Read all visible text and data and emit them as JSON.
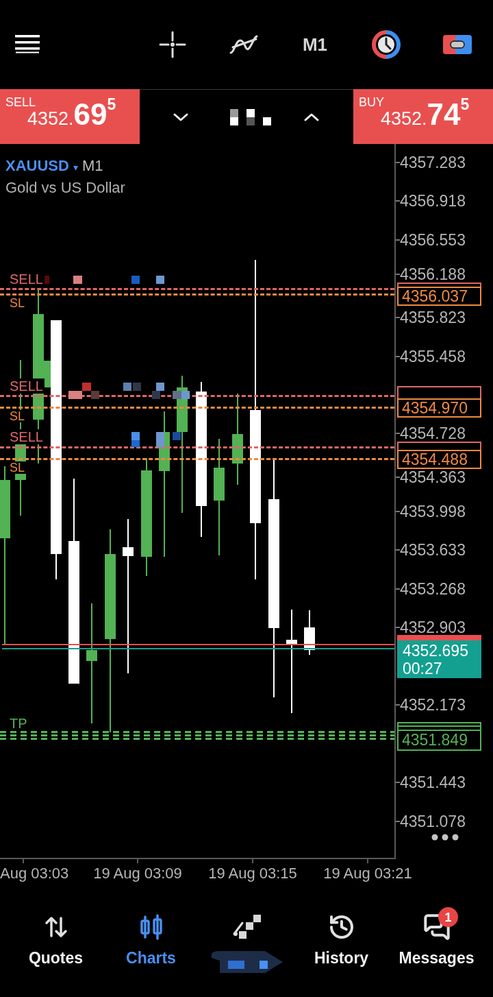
{
  "toolbar": {
    "timeframe": "M1"
  },
  "quote_bar": {
    "sell": {
      "label": "SELL",
      "price": "4352.**69**$^{5}$"
    },
    "buy": {
      "label": "BUY",
      "price": "4352.**74**$^{5}$"
    }
  },
  "chart": {
    "symbol": "XAUUSD",
    "symbol_menu_glyph": "▾",
    "timeframe": "M1",
    "description": "Gold vs US Dollar",
    "orders": [
      {
        "entry_label": "SELL",
        "sl_label": "SL",
        "sl_price": "4356.037"
      },
      {
        "entry_label": "SELL",
        "sl_label": "SL",
        "sl_price": "4354.970"
      },
      {
        "entry_label": "SELL",
        "sl_label": "SL",
        "sl_price": "4354.488"
      }
    ],
    "take_profit": {
      "label": "TP",
      "price": "4351.849"
    },
    "bid": {
      "price": "4352.695",
      "countdown": "00:27"
    },
    "price_axis": [
      "4357.283",
      "4356.918",
      "4356.553",
      "4356.188",
      "4355.823",
      "4355.458",
      "4354.728",
      "4354.363",
      "4353.998",
      "4353.633",
      "4353.268",
      "4352.903",
      "4352.173",
      "4351.443",
      "4351.078"
    ],
    "time_axis": [
      "Aug 03:03",
      "19 Aug 03:09",
      "19 Aug 03:15",
      "19 Aug 03:21"
    ]
  },
  "bottom_nav": [
    {
      "kind": "quotes",
      "label": "Quotes",
      "selected": false
    },
    {
      "kind": "charts",
      "label": "Charts",
      "selected": true
    },
    {
      "kind": "trade",
      "selected": false
    },
    {
      "kind": "history",
      "label": "History",
      "selected": false
    },
    {
      "kind": "messages",
      "label": "Messages",
      "selected": false,
      "badge": "1"
    }
  ]
}
